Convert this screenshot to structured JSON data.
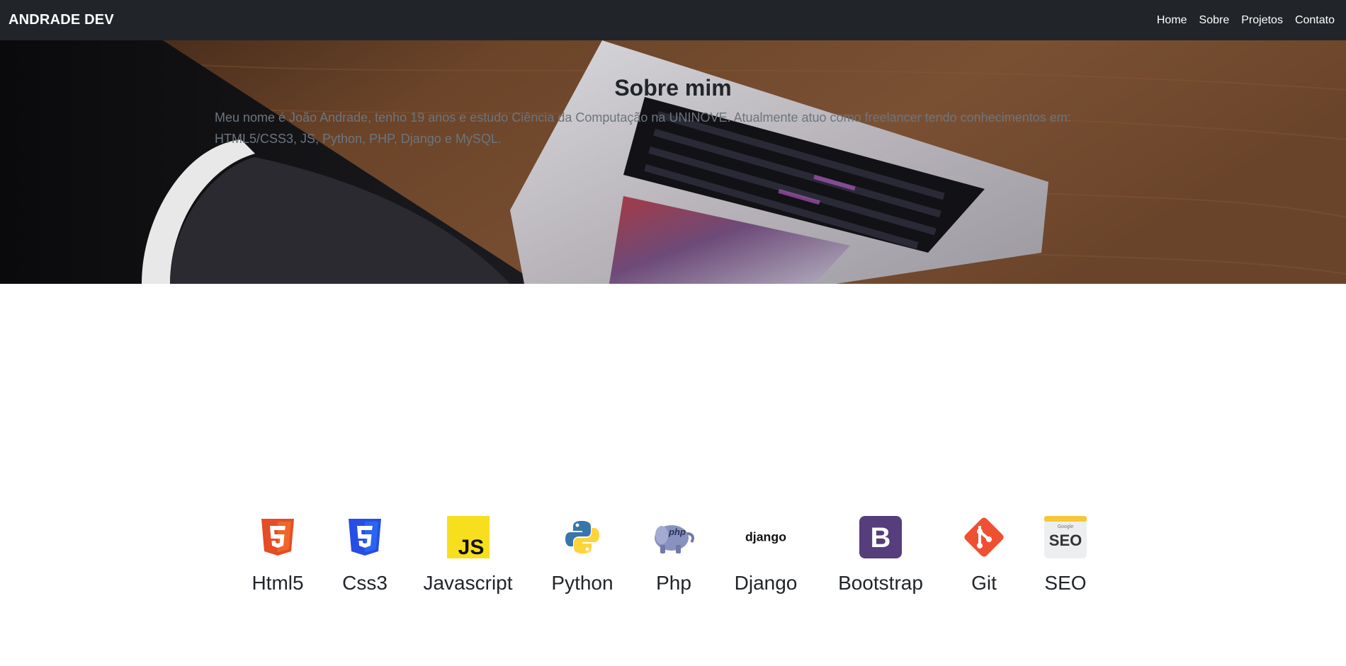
{
  "navbar": {
    "brand": "ANDRADE DEV",
    "links": [
      "Home",
      "Sobre",
      "Projetos",
      "Contato"
    ]
  },
  "about": {
    "title": "Sobre mim",
    "text": "Meu nome é João Andrade, tenho 19 anos e estudo Ciência da Computação na UNINOVE. Atualmente atuo como freelancer tendo conhecimentos em: HTML5/CSS3, JS, Python, PHP, Django e MySQL."
  },
  "skills": [
    {
      "label": "Html5",
      "icon": "html5-icon"
    },
    {
      "label": "Css3",
      "icon": "css3-icon"
    },
    {
      "label": "Javascript",
      "icon": "javascript-icon"
    },
    {
      "label": "Python",
      "icon": "python-icon"
    },
    {
      "label": "Php",
      "icon": "php-icon"
    },
    {
      "label": "Django",
      "icon": "django-icon"
    },
    {
      "label": "Bootstrap",
      "icon": "bootstrap-icon"
    },
    {
      "label": "Git",
      "icon": "git-icon"
    },
    {
      "label": "SEO",
      "icon": "seo-icon"
    }
  ],
  "icon_text": {
    "js": "JS",
    "php": "php",
    "django": "django",
    "bootstrap": "B",
    "seo": "SEO",
    "google": "Google"
  },
  "colors": {
    "navbar": "#212529",
    "html5": "#E44D26",
    "css3": "#264DE4",
    "javascript": "#F7DF1E",
    "python_blue": "#3776AB",
    "python_yellow": "#FFD43B",
    "php": "#8892BF",
    "bootstrap": "#563D7C",
    "git": "#F05032"
  }
}
